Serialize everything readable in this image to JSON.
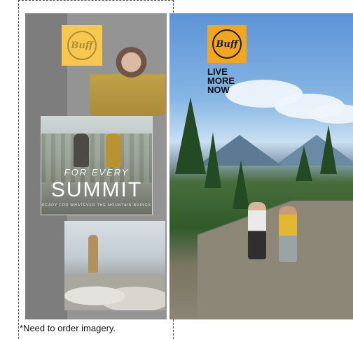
{
  "left_mockup": {
    "logo_text": "Buff",
    "summit_small": "FOR EVERY",
    "summit_big": "SUMMIT",
    "summit_tag": "READY FOR WHATEVER THE MOUNTAIN BRINGS"
  },
  "right_mockup": {
    "logo_text": "Buff",
    "tagline_lines": [
      "LIVE",
      "MORE",
      "NOW"
    ]
  },
  "note": "*Need to order imagery.",
  "colors": {
    "logo_orange": "#f2a61e",
    "logo_yellow": "#f6c84e"
  }
}
